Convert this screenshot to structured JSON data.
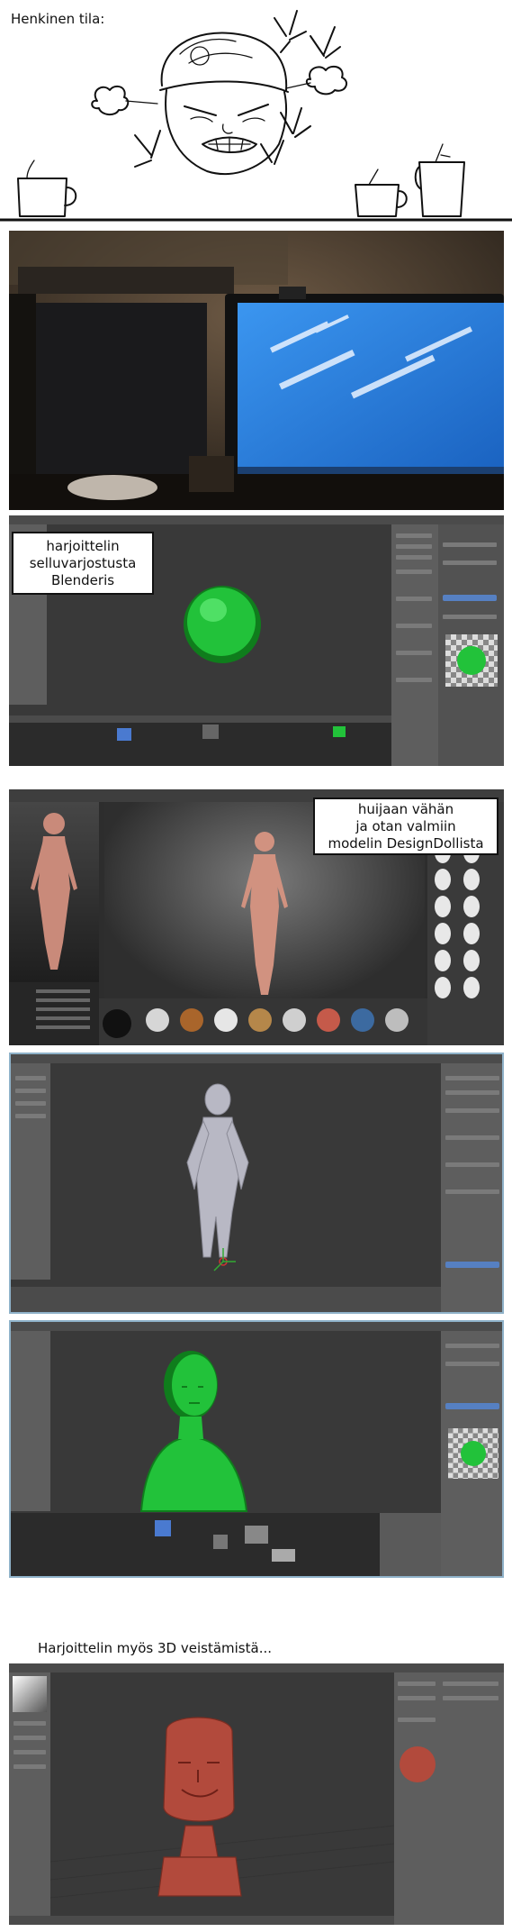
{
  "panels": {
    "sketch": {
      "caption": "Henkinen tila:"
    },
    "photo_desk": {},
    "blender_cel": {
      "bubble_lines": [
        "harjoittelin",
        "selluvarjostusta",
        "Blenderis"
      ]
    },
    "designdoll": {
      "bubble_lines": [
        "huijaan vähän",
        "ja otan valmiin",
        "modelin DesignDollista"
      ]
    },
    "blender_model": {},
    "blender_green": {},
    "sculpt": {
      "caption": "Harjoittelin myös 3D veistämistä..."
    }
  },
  "colors": {
    "cel_green": "#22c23a",
    "cel_green_dark": "#0f7d1c",
    "skin": "#c98a7a",
    "sculpt_red": "#b24a3c",
    "monitor_blue": "#2a7fd6"
  },
  "icons": [
    "steam-puff-icon",
    "anger-mark-icon",
    "coffee-cup-icon"
  ]
}
